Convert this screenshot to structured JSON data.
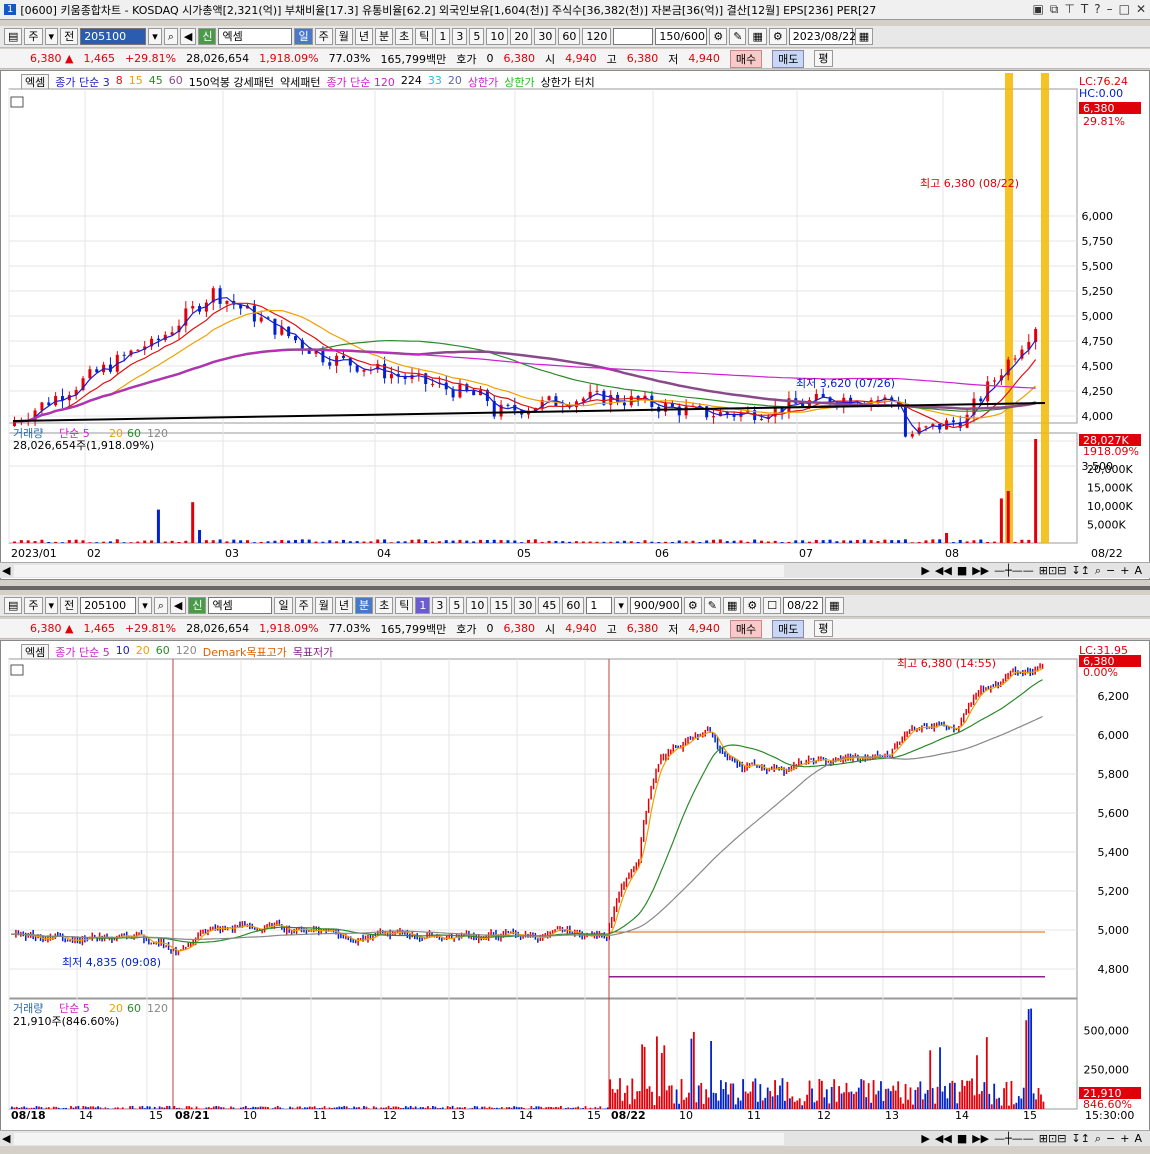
{
  "window": {
    "badge": "1",
    "title": "[0600] 키움종합차트 - KOSDAQ 시가총액[2,321(억)] 부채비율[17.3] 유통비율[62.2] 외국인보유[1,604(천)] 주식수[36,382(천)] 자본금[36(억)] 결산[12월] EPS[236] PER[27"
  },
  "top": {
    "toolbar": {
      "type": "주",
      "prev": "전",
      "code": "205100",
      "name": "엑셈",
      "periods": [
        "일",
        "주",
        "월",
        "년",
        "분",
        "초",
        "틱"
      ],
      "numbers": [
        "1",
        "3",
        "5",
        "10",
        "20",
        "30",
        "60",
        "120"
      ],
      "count": "150/600",
      "date": "2023/08/22"
    },
    "quote": {
      "price": "6,380",
      "change": "1,465",
      "pct": "+29.81%",
      "volume": "28,026,654",
      "vol_pct": "1,918.09%",
      "turn": "77.03%",
      "amount": "165,799백만",
      "hoga_label": "호가",
      "hoga": "0",
      "cur": "6,380",
      "open_label": "시",
      "open": "4,940",
      "high_label": "고",
      "high": "6,380",
      "low_label": "저",
      "low": "4,940",
      "buy": "매수",
      "sell": "매도",
      "flat": "평"
    },
    "legend": [
      "엑셈",
      "종가 단순 3",
      "8",
      "15",
      "45",
      "60",
      "150억봉 강세패턴",
      "약세패턴",
      "종가 단순 120",
      "224",
      "33",
      "20",
      "상한가",
      "상한가",
      "상한가 터치"
    ],
    "price_tag": "6,380",
    "lc_hc": [
      "LC:76.24",
      "HC:0.00"
    ],
    "pct_tag": "29.81%",
    "high_note": "최고 6,380 (08/22)",
    "low_note": "최저 3,620 (07/26)",
    "yticks": [
      "6,000",
      "5,750",
      "5,500",
      "5,250",
      "5,000",
      "4,750",
      "4,500",
      "4,250",
      "4,000",
      "3,750",
      "3,500"
    ],
    "vol_legend": [
      "거래량",
      "단순 5",
      "20",
      "60",
      "120"
    ],
    "vol_text": "28,026,654주(1,918.09%)",
    "vol_tag": "28,027K",
    "vol_pct": "1918.09%",
    "vol_ticks": [
      "20,000K",
      "15,000K",
      "10,000K",
      "5,000K"
    ],
    "xticks": [
      "2023/01",
      "02",
      "03",
      "04",
      "05",
      "06",
      "07",
      "08"
    ],
    "x_right": "08/22"
  },
  "bottom": {
    "toolbar": {
      "type": "주",
      "prev": "전",
      "code": "205100",
      "name": "엑셈",
      "periods": [
        "일",
        "주",
        "월",
        "년",
        "분",
        "초",
        "틱"
      ],
      "numbers": [
        "1",
        "3",
        "5",
        "10",
        "15",
        "30",
        "45",
        "60"
      ],
      "unit": "1",
      "count": "900/900",
      "date": "08/22"
    },
    "quote": {
      "price": "6,380",
      "change": "1,465",
      "pct": "+29.81%",
      "volume": "28,026,654",
      "vol_pct": "1,918.09%",
      "turn": "77.03%",
      "amount": "165,799백만",
      "hoga_label": "호가",
      "hoga": "0",
      "cur": "6,380",
      "open_label": "시",
      "open": "4,940",
      "high_label": "고",
      "high": "6,380",
      "low_label": "저",
      "low": "4,940",
      "buy": "매수",
      "sell": "매도",
      "flat": "평"
    },
    "legend": [
      "엑셈",
      "종가 단순 5",
      "10",
      "20",
      "60",
      "120",
      "Demark목표고가",
      "목표저가"
    ],
    "price_tag": "6,380",
    "lc": "LC:31.95",
    "pct_tag": "0.00%",
    "high_note": "최고 6,380 (14:55)",
    "low_note": "최저 4,835 (09:08)",
    "yticks": [
      "6,200",
      "6,000",
      "5,800",
      "5,600",
      "5,400",
      "5,200",
      "5,000",
      "4,800"
    ],
    "vol_legend": [
      "거래량",
      "단순 5",
      "20",
      "60",
      "120"
    ],
    "vol_text": "21,910주(846.60%)",
    "vol_tag": "21,910",
    "vol_pct": "846.60%",
    "vol_ticks": [
      "500,000",
      "250,000"
    ],
    "xticks": [
      "08/18",
      "14",
      "15",
      "08/21",
      "10",
      "11",
      "12",
      "13",
      "14",
      "15",
      "08/22",
      "10",
      "11",
      "12",
      "13",
      "14",
      "15"
    ],
    "x_right": "15:30:00"
  },
  "colors": {
    "up": "#e0000a",
    "down": "#0022cc",
    "ma3": "#1a1acc",
    "ma8": "#e01010",
    "ma15": "#f0a000",
    "ma45": "#2a8a2a",
    "ma60": "#8a4a8a",
    "ma120": "#d020d0",
    "ma224": "#20a0a0",
    "highlight": "#f5b800"
  }
}
